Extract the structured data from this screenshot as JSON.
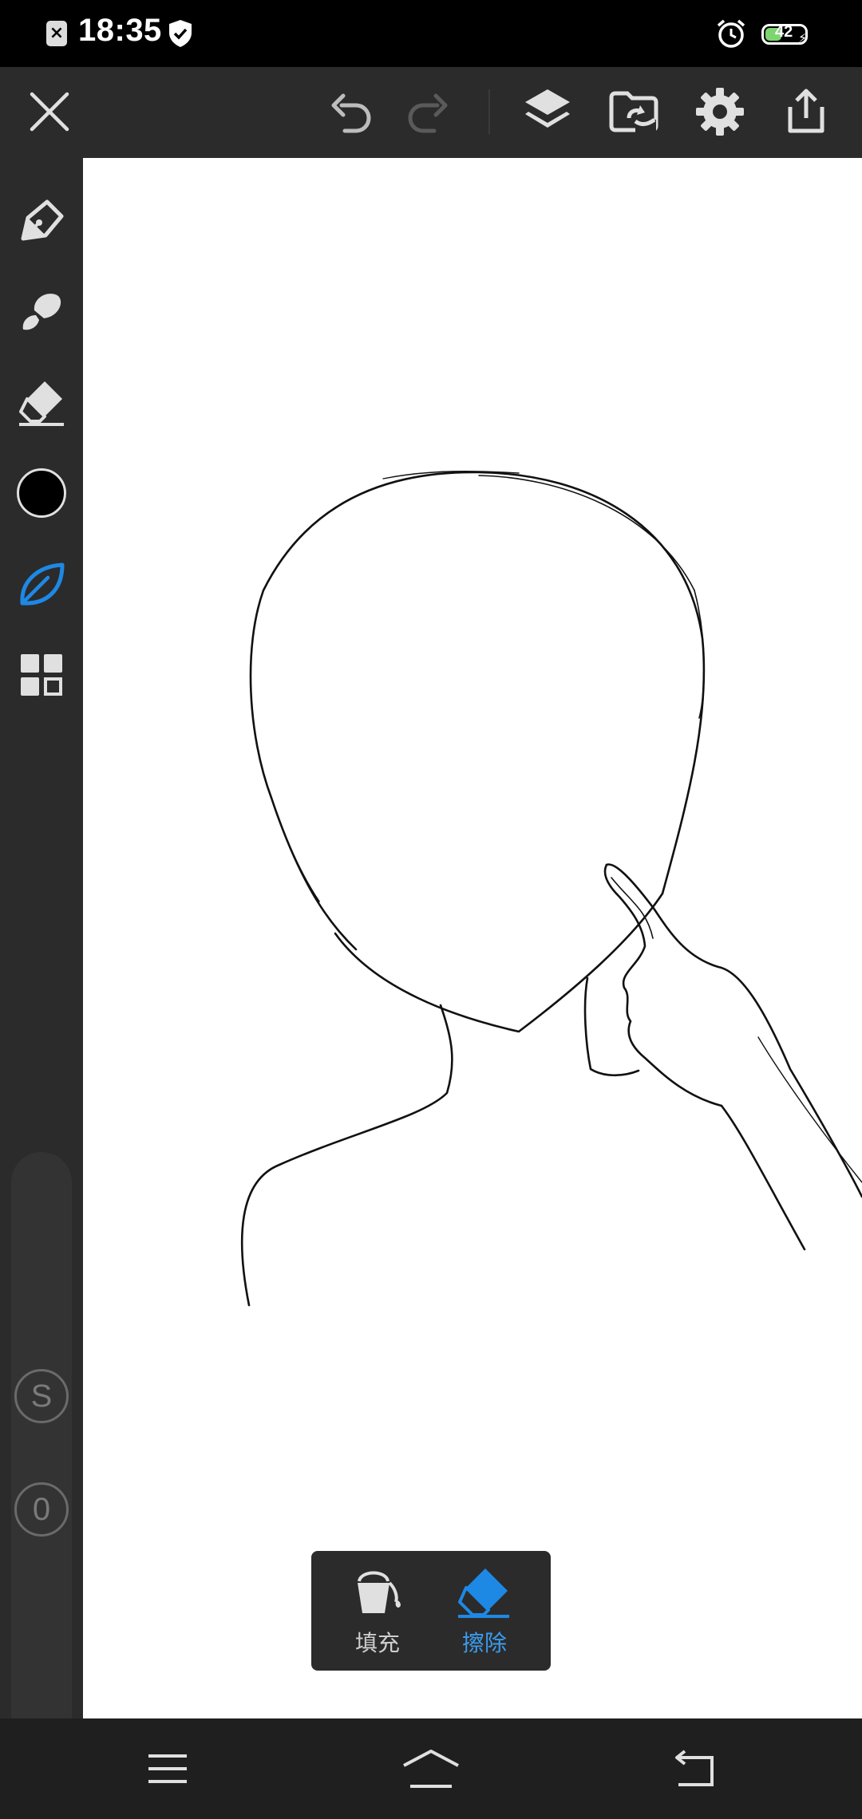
{
  "status_bar": {
    "time": "18:35",
    "battery_level": "42"
  },
  "toolbar": {
    "icons": [
      "close-icon",
      "undo-icon",
      "redo-icon",
      "layers-icon",
      "folder-import-icon",
      "settings-icon",
      "share-icon"
    ]
  },
  "sidebar": {
    "tools": [
      "pen-icon",
      "brush-icon",
      "eraser-icon",
      "color-swatch",
      "leaf-icon",
      "grid-icon"
    ],
    "selected_color": "#000000",
    "accent_color": "#1e88e5",
    "size_knob_label": "S",
    "opacity_knob_label": "0"
  },
  "fill_popup": {
    "fill_label": "填充",
    "erase_label": "擦除",
    "active": "擦除"
  },
  "nav_bar": {
    "icons": [
      "menu-icon",
      "home-icon",
      "back-icon"
    ]
  }
}
